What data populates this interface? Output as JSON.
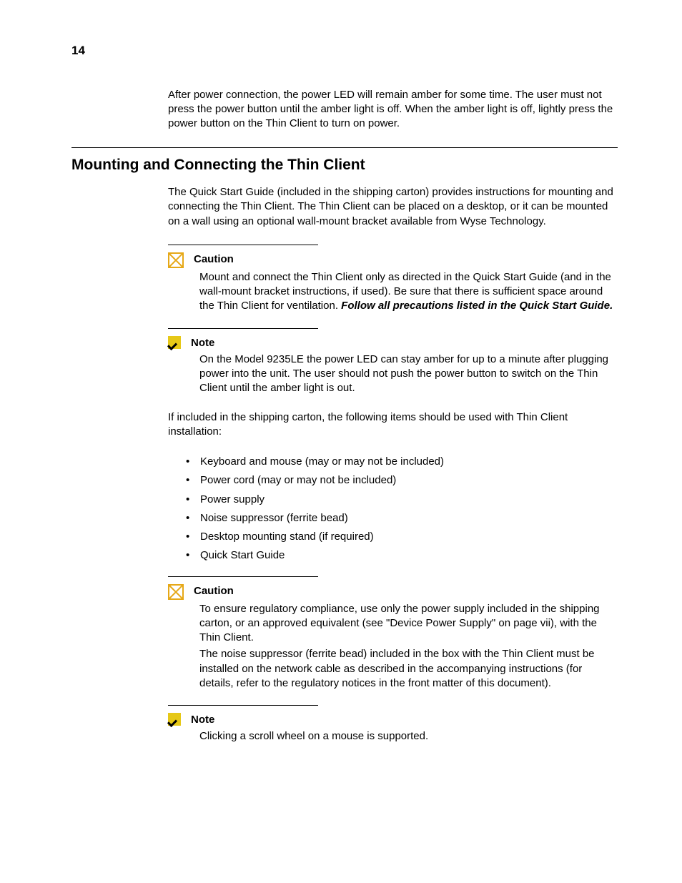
{
  "pageNumber": "14",
  "intro": "After power connection, the power LED will remain amber for some time. The user must not press the power button until the amber light is off. When the amber light is off, lightly press the power button on the Thin Client to turn on power.",
  "heading": "Mounting and Connecting the Thin Client",
  "para1": "The Quick Start Guide (included in the shipping carton) provides instructions for mounting and connecting the Thin Client. The Thin Client can be placed on a desktop, or it can be mounted on a wall using an optional wall-mount bracket available from Wyse Technology.",
  "caution1": {
    "title": "Caution",
    "body": "Mount and connect the Thin Client only as directed in the Quick Start Guide (and in the wall-mount bracket instructions, if used). Be sure that there is sufficient space around the Thin Client for ventilation. ",
    "emph": "Follow all precautions listed in the Quick Start Guide."
  },
  "note1": {
    "title": "Note",
    "body": "On the Model 9235LE the power LED can stay amber for up to a minute after plugging power into the unit. The user should not push the power button to switch on the Thin Client until the amber light is out."
  },
  "para2": "If included in the shipping carton, the following items should be used with Thin Client installation:",
  "items": [
    "Keyboard and mouse (may or may not be included)",
    "Power cord (may or may not be included)",
    "Power supply",
    "Noise suppressor (ferrite bead)",
    "Desktop mounting stand (if required)",
    "Quick Start Guide"
  ],
  "caution2": {
    "title": "Caution",
    "body1": "To ensure regulatory compliance, use only the power supply included in the shipping carton, or an approved equivalent (see \"Device Power Supply\" on page vii), with the Thin Client.",
    "body2": "The noise suppressor (ferrite bead) included in the box with the Thin Client must be installed on the network cable as described in the accompanying instructions (for details, refer to the regulatory notices in the front matter of this document)."
  },
  "note2": {
    "title": "Note",
    "body": "Clicking a scroll wheel on a mouse is supported."
  }
}
